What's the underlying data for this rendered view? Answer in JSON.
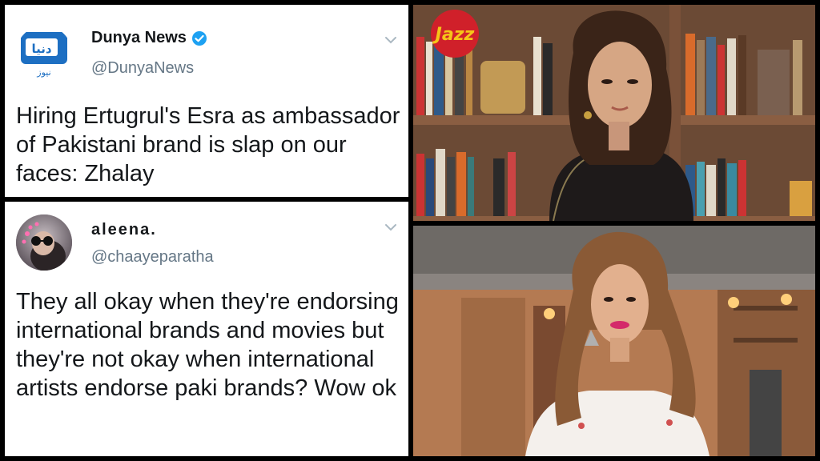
{
  "tweets": [
    {
      "display_name": "Dunya News",
      "handle": "@DunyaNews",
      "verified": true,
      "avatar_icon": "dunya-news-logo",
      "avatar_logo_text": "دنیا",
      "avatar_logo_subtext": "نیوز",
      "text": "Hiring Ertugrul's Esra as ambassador of Pakistani brand is slap on our faces: Zhalay"
    },
    {
      "display_name": "aleena.",
      "handle": "@chaayeparatha",
      "verified": false,
      "avatar_icon": "user-photo",
      "text": "They all okay when they're endorsing international brands and movies but they're not okay when international artists endorse paki brands? Wow ok"
    }
  ],
  "photos": [
    {
      "subject": "woman-in-front-of-bookshelf",
      "logo_text": "Jazz"
    },
    {
      "subject": "woman-in-cafe"
    }
  ],
  "colors": {
    "dunya_blue": "#1d6fc2",
    "verified_blue": "#1da1f2",
    "jazz_red": "#d0202a",
    "jazz_yellow": "#f5c518"
  }
}
